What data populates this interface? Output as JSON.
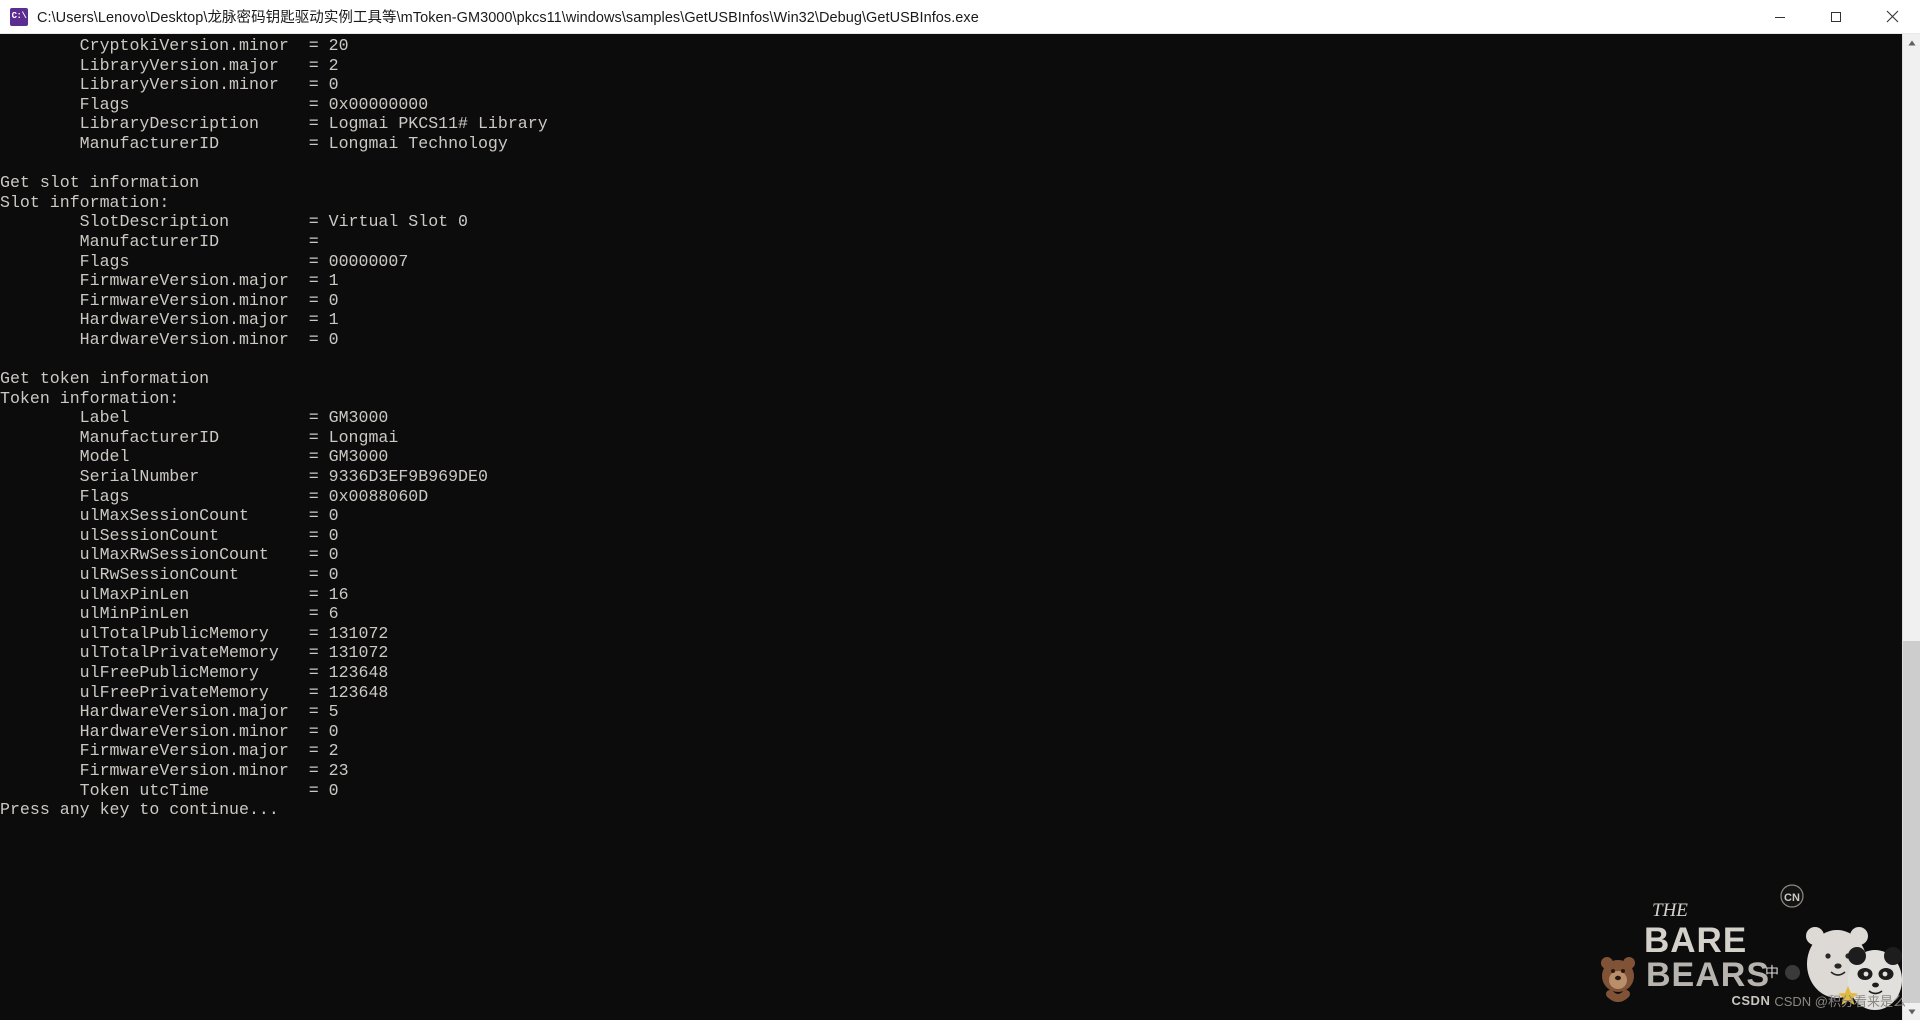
{
  "window": {
    "title": "C:\\Users\\Lenovo\\Desktop\\龙脉密码钥匙驱动实例工具等\\mToken-GM3000\\pkcs11\\windows\\samples\\GetUSBInfos\\Win32\\Debug\\GetUSBInfos.exe",
    "icon_glyph": "C:\\",
    "icon_name": "cmd-console-icon",
    "background": "#0c0c0c",
    "foreground": "#ccc9c4",
    "titlebar_background": "#ffffff",
    "buttons": {
      "minimize": "Minimize",
      "maximize": "Maximize",
      "close": "Close"
    }
  },
  "console": {
    "lines": [
      "        CryptokiVersion.minor  = 20",
      "        LibraryVersion.major   = 2",
      "        LibraryVersion.minor   = 0",
      "        Flags                  = 0x00000000",
      "        LibraryDescription     = Logmai PKCS11# Library",
      "        ManufacturerID         = Longmai Technology",
      "",
      "Get slot information",
      "Slot information:",
      "        SlotDescription        = Virtual Slot 0",
      "        ManufacturerID         =",
      "        Flags                  = 00000007",
      "        FirmwareVersion.major  = 1",
      "        FirmwareVersion.minor  = 0",
      "        HardwareVersion.major  = 1",
      "        HardwareVersion.minor  = 0",
      "",
      "Get token information",
      "Token information:",
      "        Label                  = GM3000",
      "        ManufacturerID         = Longmai",
      "        Model                  = GM3000",
      "        SerialNumber           = 9336D3EF9B969DE0",
      "        Flags                  = 0x0088060D",
      "        ulMaxSessionCount      = 0",
      "        ulSessionCount         = 0",
      "        ulMaxRwSessionCount    = 0",
      "        ulRwSessionCount       = 0",
      "        ulMaxPinLen            = 16",
      "        ulMinPinLen            = 6",
      "        ulTotalPublicMemory    = 131072",
      "        ulTotalPrivateMemory   = 131072",
      "        ulFreePublicMemory     = 123648",
      "        ulFreePrivateMemory    = 123648",
      "        HardwareVersion.major  = 5",
      "        HardwareVersion.minor  = 0",
      "        FirmwareVersion.major  = 2",
      "        FirmwareVersion.minor  = 23",
      "        Token utcTime          = 0",
      "Press any key to continue..."
    ]
  },
  "scrollbar": {
    "up_arrow": "▲",
    "down_arrow": "▼"
  },
  "watermark": {
    "brand_line1": "THE",
    "brand_line2": "BARE",
    "brand_line3": "BEARS",
    "network_tag": "CN",
    "credit": "CSDN @积分看来是么",
    "csdn_mark": "CSDN",
    "ime_label": "中"
  }
}
